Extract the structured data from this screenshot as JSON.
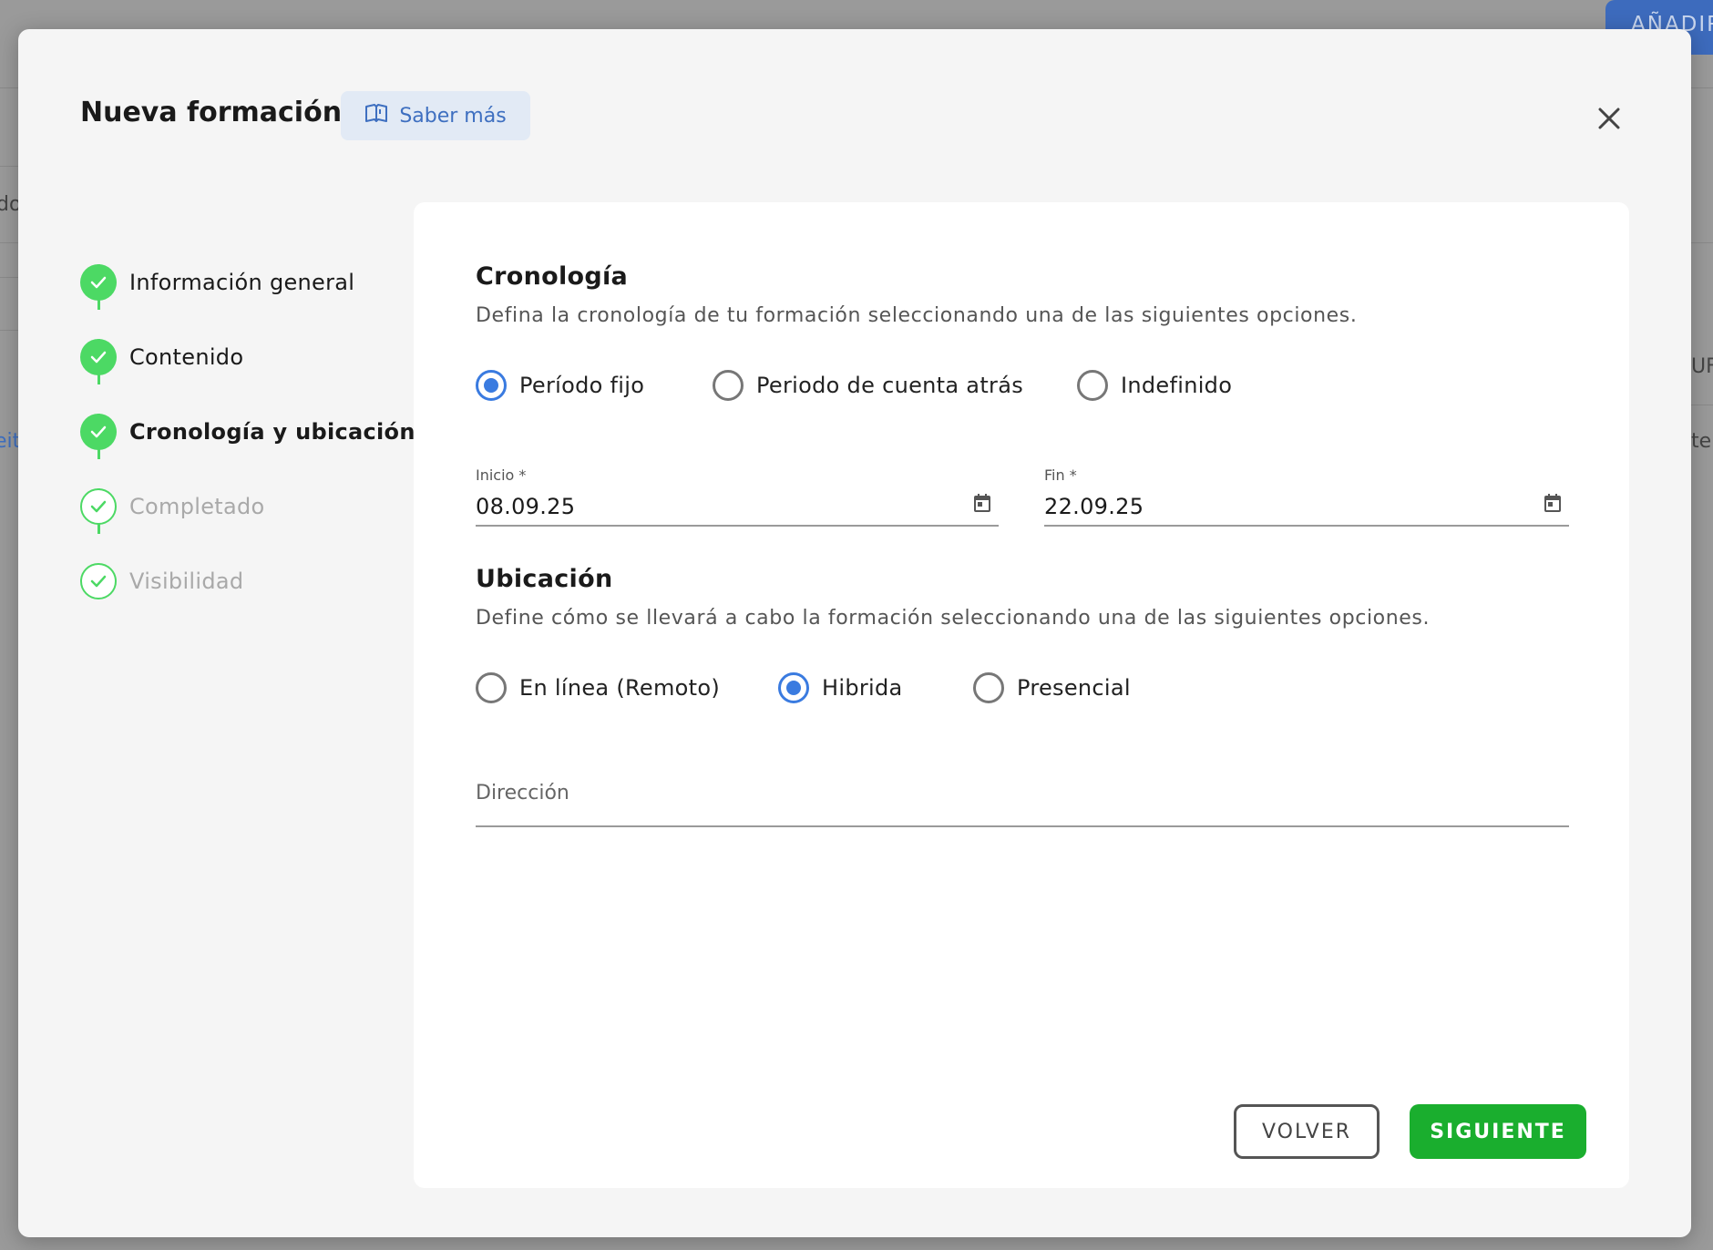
{
  "background": {
    "top_button": "AÑADIR",
    "fragments": [
      "do",
      "eit",
      "UF",
      "ter"
    ]
  },
  "modal": {
    "title": "Nueva formación",
    "learn_more": "Saber más"
  },
  "steps": [
    {
      "label": "Información general",
      "state": "done"
    },
    {
      "label": "Contenido",
      "state": "done"
    },
    {
      "label": "Cronología y ubicación",
      "state": "active"
    },
    {
      "label": "Completado",
      "state": "pending"
    },
    {
      "label": "Visibilidad",
      "state": "pending"
    }
  ],
  "chronology": {
    "title": "Cronología",
    "description": "Defina la cronología de tu formación seleccionando una de las siguientes opciones.",
    "options": [
      "Período fijo",
      "Periodo de cuenta atrás",
      "Indefinido"
    ],
    "selected": "Período fijo",
    "start": {
      "label": "Inicio *",
      "value": "08.09.25"
    },
    "end": {
      "label": "Fin *",
      "value": "22.09.25"
    }
  },
  "location": {
    "title": "Ubicación",
    "description": "Define cómo se llevará a cabo la formación seleccionando una de las siguientes opciones.",
    "options": [
      "En línea (Remoto)",
      "Hibrida",
      "Presencial"
    ],
    "selected": "Hibrida",
    "address_placeholder": "Dirección"
  },
  "actions": {
    "back": "VOLVER",
    "next": "SIGUIENTE"
  },
  "colors": {
    "accent_blue": "#3a7be0",
    "step_green": "#4cd964",
    "primary_green": "#1aae2e"
  }
}
